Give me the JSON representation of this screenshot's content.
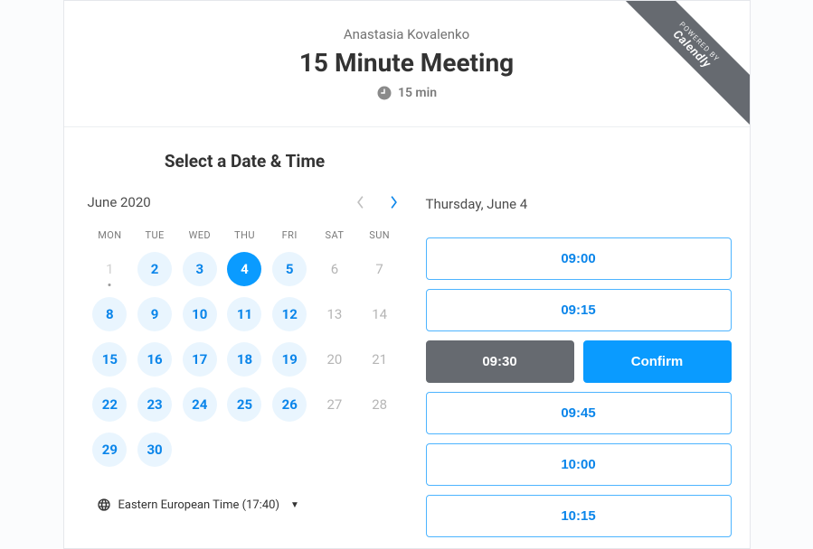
{
  "ribbon": {
    "line1": "POWERED BY",
    "line2": "Calendly"
  },
  "header": {
    "host": "Anastasia Kovalenko",
    "title": "15 Minute Meeting",
    "duration": "15 min"
  },
  "section_title": "Select a Date & Time",
  "calendar": {
    "month_label": "June 2020",
    "weekdays": [
      "MON",
      "TUE",
      "WED",
      "THU",
      "FRI",
      "SAT",
      "SUN"
    ],
    "weeks": [
      [
        {
          "n": "1",
          "state": "past",
          "today": true
        },
        {
          "n": "2",
          "state": "available"
        },
        {
          "n": "3",
          "state": "available"
        },
        {
          "n": "4",
          "state": "selected"
        },
        {
          "n": "5",
          "state": "available"
        },
        {
          "n": "6",
          "state": "disabled"
        },
        {
          "n": "7",
          "state": "disabled"
        }
      ],
      [
        {
          "n": "8",
          "state": "available"
        },
        {
          "n": "9",
          "state": "available"
        },
        {
          "n": "10",
          "state": "available"
        },
        {
          "n": "11",
          "state": "available"
        },
        {
          "n": "12",
          "state": "available"
        },
        {
          "n": "13",
          "state": "disabled"
        },
        {
          "n": "14",
          "state": "disabled"
        }
      ],
      [
        {
          "n": "15",
          "state": "available"
        },
        {
          "n": "16",
          "state": "available"
        },
        {
          "n": "17",
          "state": "available"
        },
        {
          "n": "18",
          "state": "available"
        },
        {
          "n": "19",
          "state": "available"
        },
        {
          "n": "20",
          "state": "disabled"
        },
        {
          "n": "21",
          "state": "disabled"
        }
      ],
      [
        {
          "n": "22",
          "state": "available"
        },
        {
          "n": "23",
          "state": "available"
        },
        {
          "n": "24",
          "state": "available"
        },
        {
          "n": "25",
          "state": "available"
        },
        {
          "n": "26",
          "state": "available"
        },
        {
          "n": "27",
          "state": "disabled"
        },
        {
          "n": "28",
          "state": "disabled"
        }
      ],
      [
        {
          "n": "29",
          "state": "available"
        },
        {
          "n": "30",
          "state": "available"
        },
        {
          "n": "",
          "state": "empty"
        },
        {
          "n": "",
          "state": "empty"
        },
        {
          "n": "",
          "state": "empty"
        },
        {
          "n": "",
          "state": "empty"
        },
        {
          "n": "",
          "state": "empty"
        }
      ]
    ]
  },
  "timezone": {
    "label": "Eastern European Time (17:40)"
  },
  "selected_date_label": "Thursday, June 4",
  "slots": [
    {
      "time": "09:00",
      "selected": false
    },
    {
      "time": "09:15",
      "selected": false
    },
    {
      "time": "09:30",
      "selected": true
    },
    {
      "time": "09:45",
      "selected": false
    },
    {
      "time": "10:00",
      "selected": false
    },
    {
      "time": "10:15",
      "selected": false
    }
  ],
  "confirm_label": "Confirm"
}
